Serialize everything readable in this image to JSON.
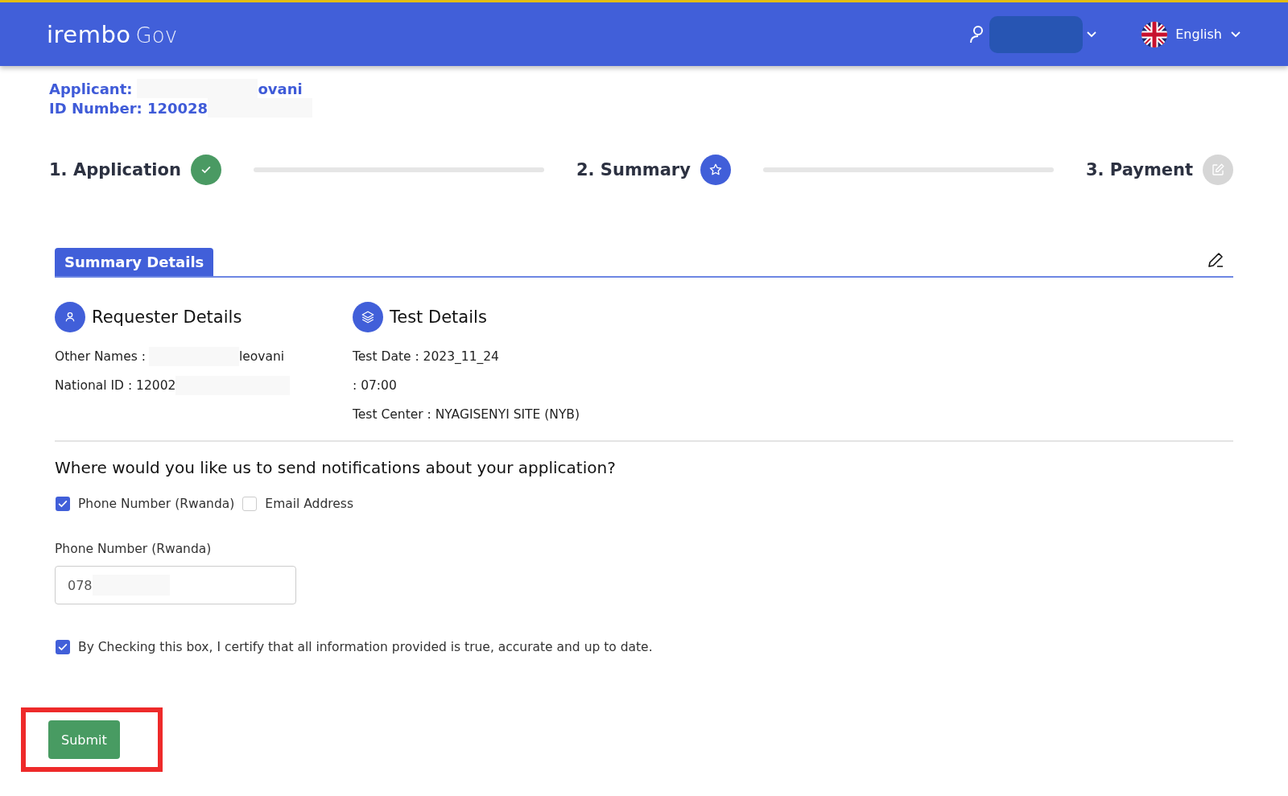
{
  "header": {
    "logo_main": "irembo",
    "logo_sub": "Gov",
    "language": "English"
  },
  "applicant": [
    {
      "before": "Applicant:",
      "after": "ovani"
    },
    {
      "before": "ID Number: 120028"
    }
  ],
  "steps": [
    {
      "label": "1. Application",
      "kind": "done"
    },
    {
      "label": "2. Summary",
      "kind": "current"
    },
    {
      "label": "3. Payment",
      "kind": "pending"
    }
  ],
  "summary": {
    "tab": "Summary Details",
    "sections": [
      {
        "kind": "person",
        "title": "Requester Details",
        "rows": [
          {
            "before": "Other Names :",
            "after": "leovani",
            "redacted": true
          },
          {
            "before": "National ID : 12002",
            "redacted": true
          }
        ]
      },
      {
        "kind": "layers",
        "title": "Test Details",
        "rows": [
          {
            "before": "Test Date : 2023_11_24"
          },
          {
            "before": ": 07:00"
          },
          {
            "before": "Test Center : NYAGISENYI SITE (NYB)"
          }
        ]
      }
    ]
  },
  "notifications": {
    "question": "Where would you like us to send notifications about your application?",
    "options": [
      {
        "label": "Phone Number (Rwanda)",
        "checked": true
      },
      {
        "label": "Email Address",
        "checked": false
      }
    ],
    "phone_label": "Phone Number (Rwanda)",
    "phone_value": "078"
  },
  "certify": {
    "label": "By Checking this box, I certify that all information provided is true, accurate and up to date.",
    "checked": true
  },
  "submit": "Submit"
}
